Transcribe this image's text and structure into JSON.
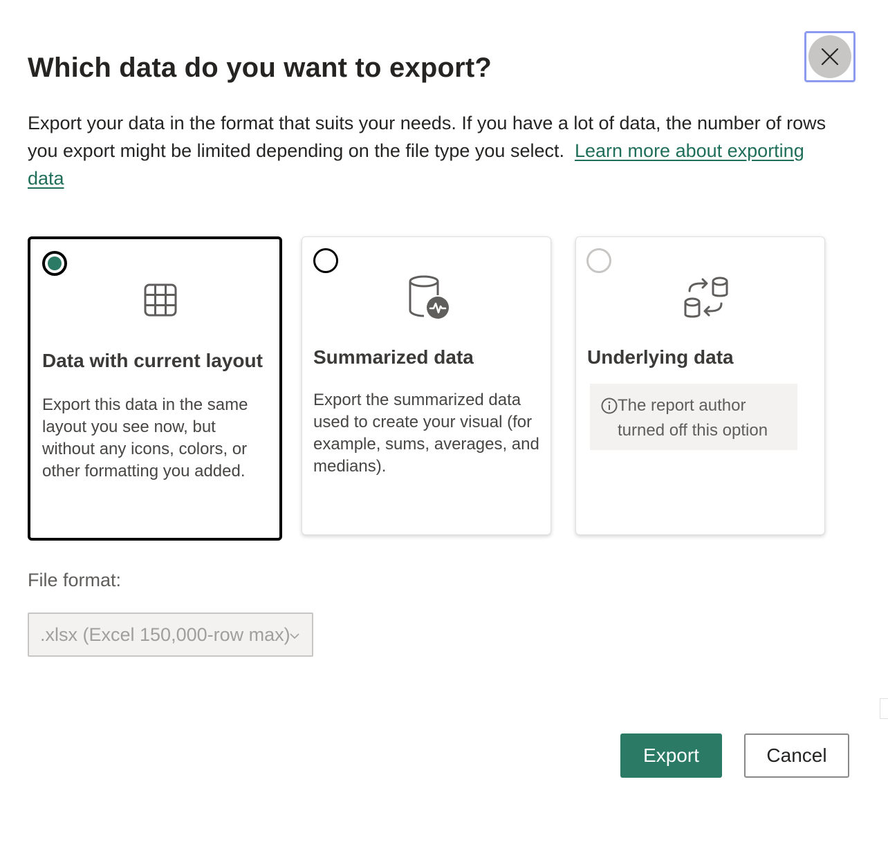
{
  "dialog": {
    "title": "Which data do you want to export?",
    "description": "Export your data in the format that suits your needs. If you have a lot of data, the number of rows you export might be limited depending on the file type you select.",
    "learn_more_link": "Learn more about exporting data",
    "close_icon": "close-icon"
  },
  "options": [
    {
      "title": "Data with current layout",
      "description": "Export this data in the same layout you see now, but without any icons, colors, or other formatting you added.",
      "icon": "table-grid-icon",
      "selected": true
    },
    {
      "title": "Summarized data",
      "description": "Export the summarized data used to create your visual (for example, sums, averages, and medians).",
      "icon": "database-pulse-icon",
      "selected": false
    },
    {
      "title": "Underlying data",
      "notice": "The report author turned off this option",
      "icon": "database-sync-icon",
      "selected": false,
      "disabled": true
    }
  ],
  "file_format": {
    "label": "File format:",
    "selected": ".xlsx (Excel 150,000-row max)"
  },
  "actions": {
    "export_label": "Export",
    "cancel_label": "Cancel"
  },
  "colors": {
    "accent": "#2b7a66",
    "link": "#1f6e5a",
    "focus_ring": "#8c9bf0"
  }
}
